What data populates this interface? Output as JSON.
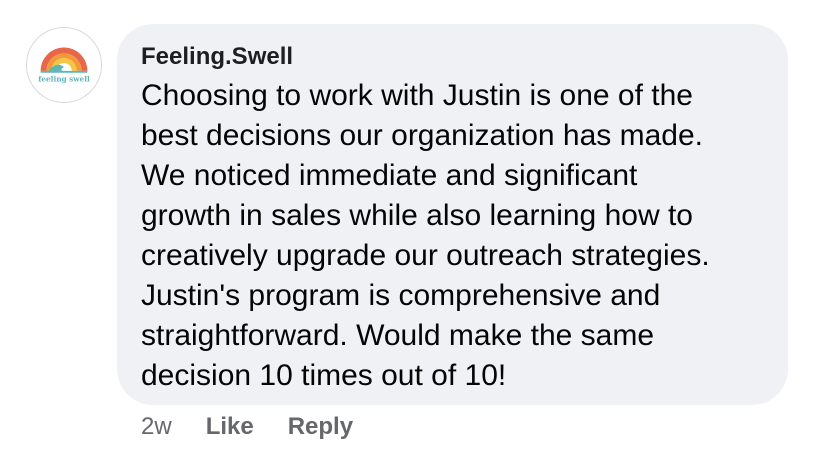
{
  "comment": {
    "author": "Feeling.Swell",
    "avatar_icon": "feeling-swell-logo",
    "avatar_text": "feeling swell",
    "text": "Choosing to work with Justin is one of the\nbest decisions our organization has made.\nWe noticed immediate and significant\ngrowth in sales while also learning how to\ncreatively upgrade our outreach strategies.\nJustin's program is comprehensive and\nstraightforward. Would make the same\ndecision 10 times out of 10!",
    "timestamp": "2w",
    "like_label": "Like",
    "reply_label": "Reply"
  },
  "colors": {
    "bubble": "#eff1f4",
    "author": "#1c1e21",
    "meta": "#65676b",
    "logo_red": "#e8664a",
    "logo_orange": "#f29a3a",
    "logo_yellow": "#f6c544",
    "logo_teal": "#5bb5ba"
  }
}
